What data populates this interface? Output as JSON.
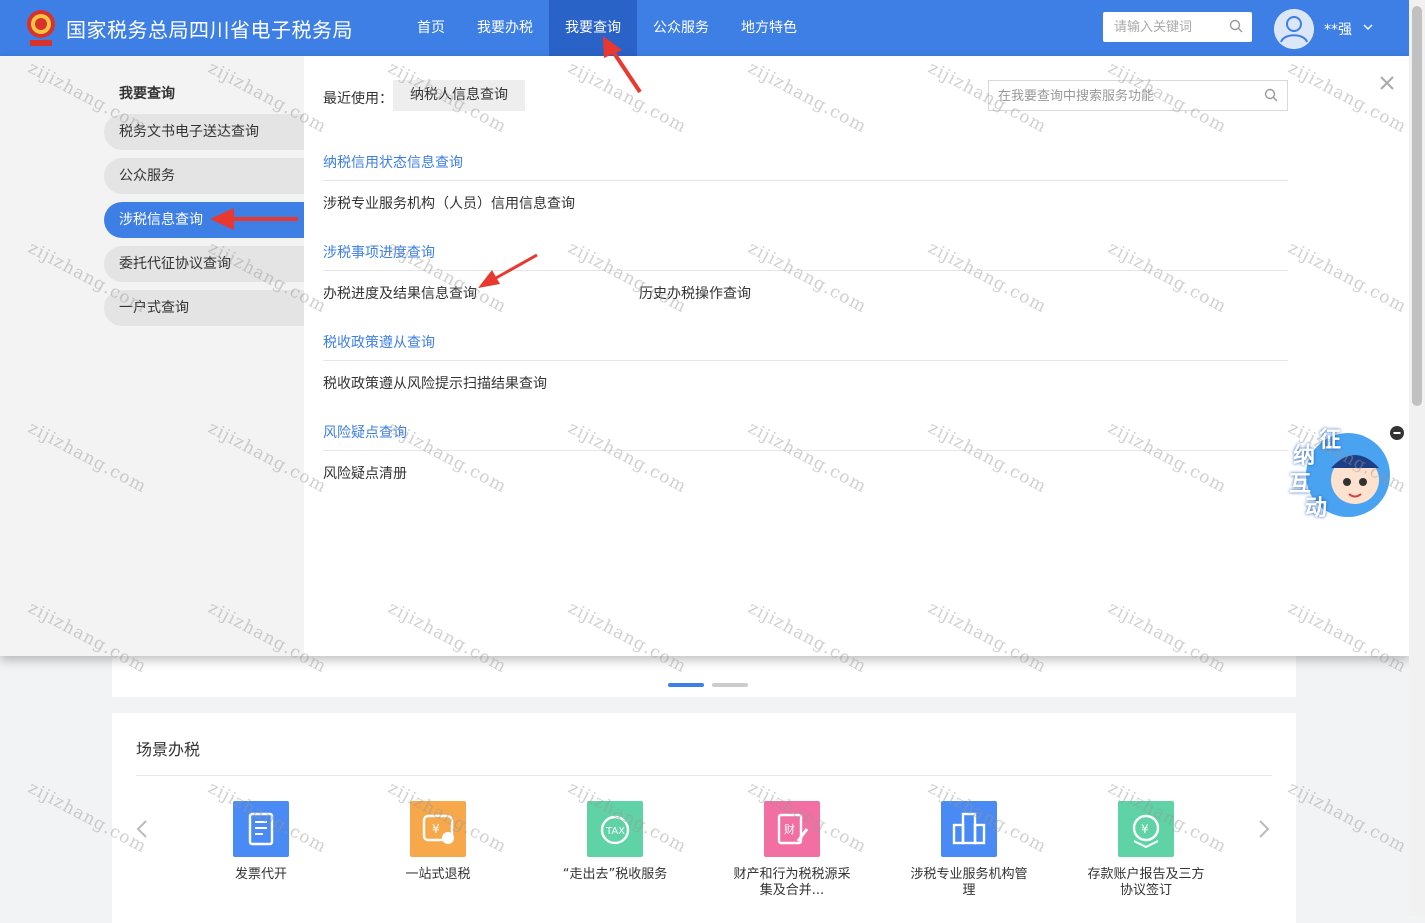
{
  "header": {
    "site_title": "国家税务总局四川省电子税务局",
    "nav": [
      "首页",
      "我要办税",
      "我要查询",
      "公众服务",
      "地方特色"
    ],
    "active_nav": "我要查询",
    "search_placeholder": "请输入关键词",
    "user_name": "**强",
    "brand_color": "#3e7fe6"
  },
  "panel": {
    "side_title": "我要查询",
    "side_items": [
      "税务文书电子送达查询",
      "公众服务",
      "涉税信息查询",
      "委托代征协议查询",
      "一户式查询"
    ],
    "active_side_item": "涉税信息查询",
    "recent_label": "最近使用：",
    "recent_item": "纳税人信息查询",
    "search_placeholder": "在我要查询中搜索服务功能",
    "sections": [
      {
        "title": "纳税信用状态信息查询",
        "links": [
          "涉税专业服务机构（人员）信用信息查询"
        ]
      },
      {
        "title": "涉税事项进度查询",
        "links": [
          "办税进度及结果信息查询",
          "历史办税操作查询"
        ]
      },
      {
        "title": "税收政策遵从查询",
        "links": [
          "税收政策遵从风险提示扫描结果查询"
        ]
      },
      {
        "title": "风险疑点查询",
        "links": [
          "风险疑点清册"
        ]
      }
    ]
  },
  "scene": {
    "title": "场景办税",
    "items": [
      {
        "label": "发票代开",
        "icon": "invoice-icon",
        "color": "#4a8af4"
      },
      {
        "label": "一站式退税",
        "icon": "tax-refund-icon",
        "color": "#f6a84b"
      },
      {
        "label": "“走出去”税收服务",
        "icon": "tax-globe-icon",
        "color": "#5fd3a5"
      },
      {
        "label": "财产和行为税税源采集及合并...",
        "icon": "property-tax-icon",
        "color": "#f26fa3"
      },
      {
        "label": "涉税专业服务机构管理",
        "icon": "building-icon",
        "color": "#4a8af4"
      },
      {
        "label": "存款账户报告及三方协议签订",
        "icon": "account-icon",
        "color": "#5fd3a5"
      }
    ]
  },
  "float_widget": {
    "label": [
      "征",
      "纳",
      "互",
      "动"
    ]
  },
  "watermark": "zijizhang.com"
}
